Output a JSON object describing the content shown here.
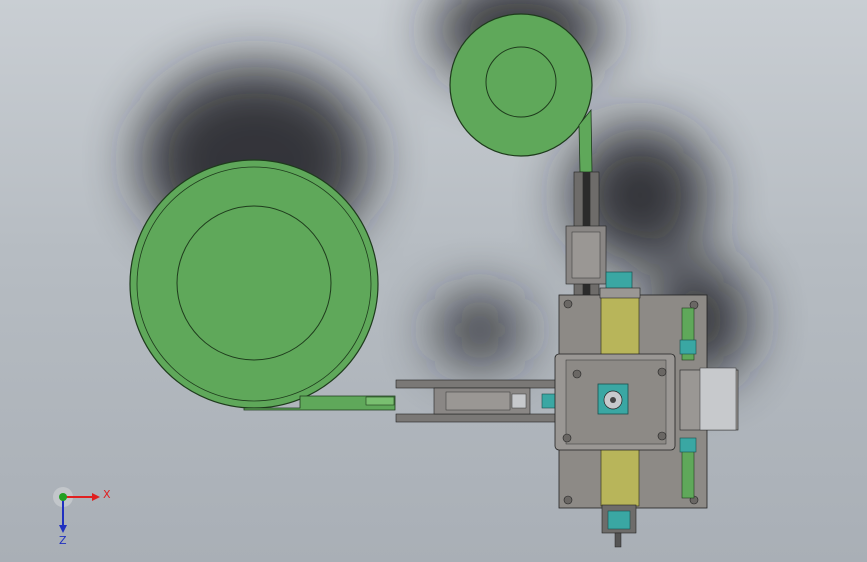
{
  "viewport": {
    "background_top": "#c9ced3",
    "background_bottom": "#a9afb6"
  },
  "colors": {
    "green_fill": "#5fa85a",
    "green_light": "#79bf70",
    "green_stroke": "#1e3b1c",
    "plate": "#8d8a86",
    "plate_dark": "#6f6c69",
    "yellow_rail": "#b8b55a",
    "teal": "#3aa7a3",
    "steel": "#c7c9cc",
    "axis_x": "#e02020",
    "axis_y": "#22a022",
    "axis_z": "#2030c0"
  },
  "triad": {
    "x_label": "X",
    "z_label": "Z"
  },
  "icons": {
    "triad": "xyz-axis-triad-icon"
  }
}
